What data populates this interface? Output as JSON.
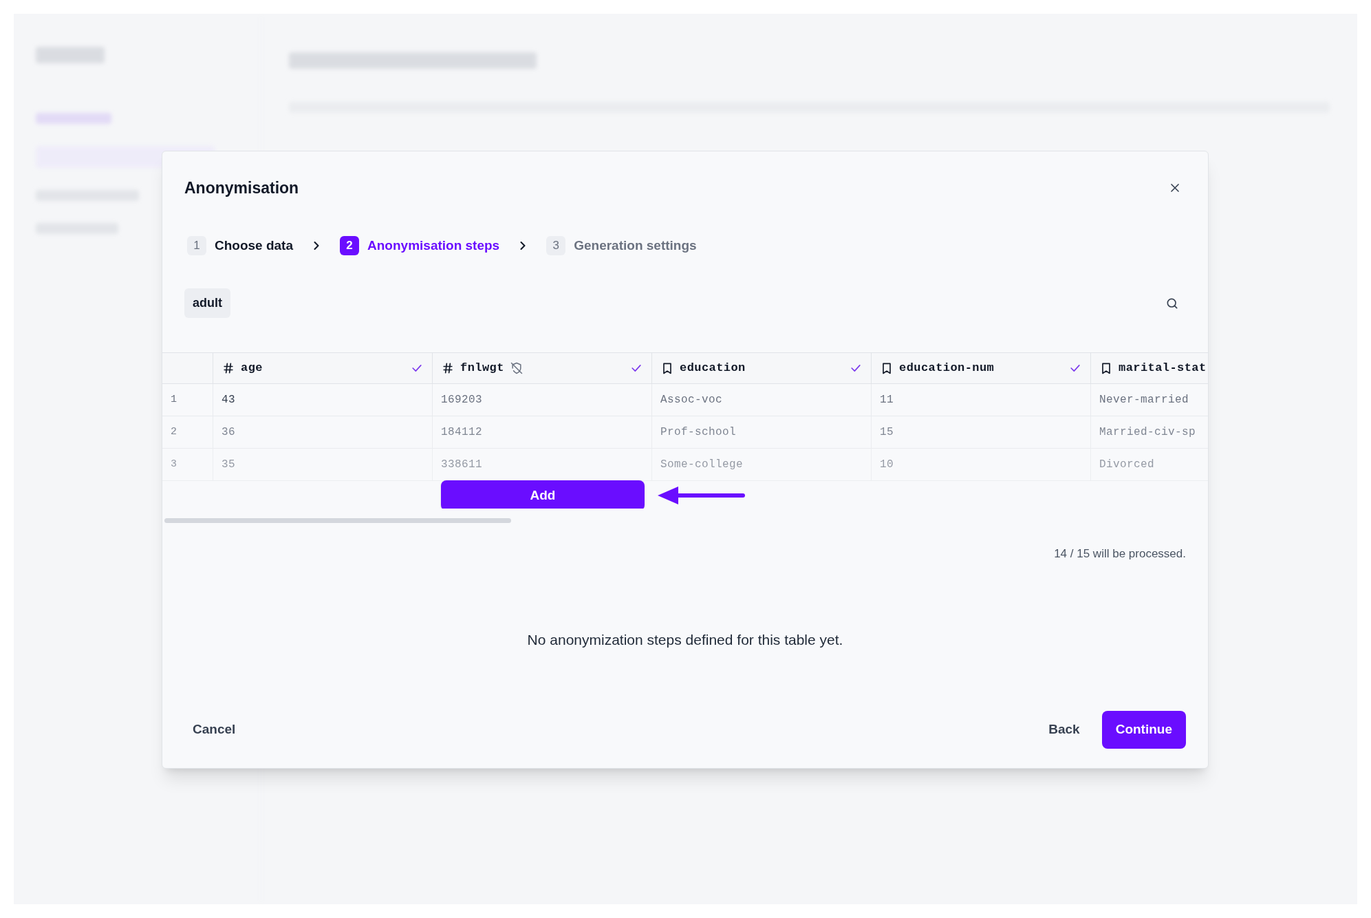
{
  "dialog": {
    "title": "Anonymisation",
    "steps": [
      {
        "number": "1",
        "label": "Choose data",
        "selected": false,
        "completed": true
      },
      {
        "number": "2",
        "label": "Anonymisation steps",
        "selected": true
      },
      {
        "number": "3",
        "label": "Generation settings",
        "selected": false,
        "completed": false
      }
    ],
    "table_tag": "adult",
    "table": {
      "columns": [
        {
          "kind": "number",
          "name": "age",
          "checked": true,
          "shield_off": false
        },
        {
          "kind": "number",
          "name": "fnlwgt",
          "checked": true,
          "shield_off": true
        },
        {
          "kind": "text",
          "name": "education",
          "checked": true,
          "shield_off": false
        },
        {
          "kind": "text",
          "name": "education-num",
          "checked": true,
          "shield_off": false
        },
        {
          "kind": "text",
          "name": "marital-stat"
        }
      ],
      "rows": [
        {
          "index": "1",
          "cells": [
            "43",
            "169203",
            "Assoc-voc",
            "11",
            "Never-married"
          ]
        },
        {
          "index": "2",
          "cells": [
            "36",
            "184112",
            "Prof-school",
            "15",
            "Married-civ-sp"
          ]
        },
        {
          "index": "3",
          "cells": [
            "35",
            "338611",
            "Some-college",
            "10",
            "Divorced"
          ]
        }
      ]
    },
    "add_button": "Add",
    "processed_note": "14 / 15 will be processed.",
    "empty_message": "No anonymization steps defined for this table yet.",
    "buttons": {
      "cancel": "Cancel",
      "back": "Back",
      "continue": "Continue"
    }
  }
}
